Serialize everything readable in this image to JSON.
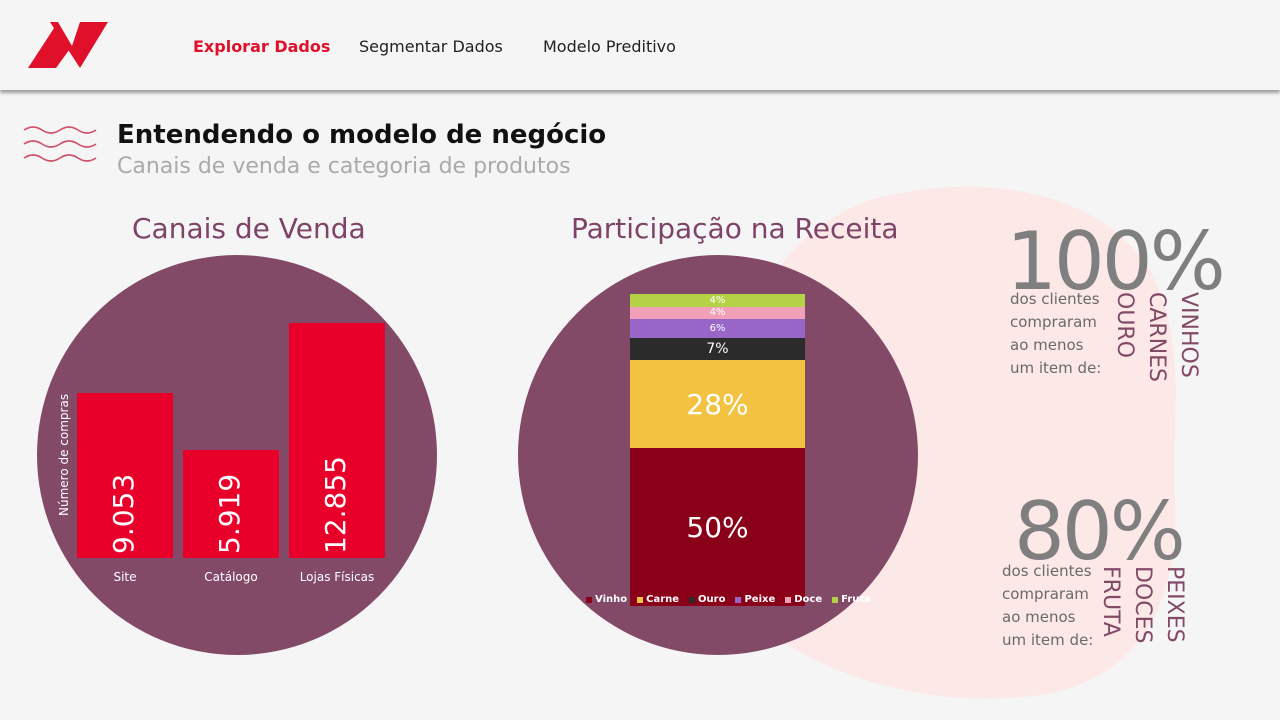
{
  "nav": {
    "items": [
      {
        "label": "Explorar Dados",
        "active": true
      },
      {
        "label": "Segmentar Dados",
        "active": false
      },
      {
        "label": "Modelo Preditivo",
        "active": false
      }
    ]
  },
  "header": {
    "title": "Entendendo o modelo de negócio",
    "subtitle": "Canais de venda  e categoria de produtos"
  },
  "colors": {
    "accent": "#e0102a",
    "circle": "#834a68",
    "bar": "#e8002a"
  },
  "chart_data": [
    {
      "type": "bar",
      "title": "Canais de Venda",
      "ylabel": "Número de compras",
      "categories": [
        "Site",
        "Catálogo",
        "Lojas Físicas"
      ],
      "values": [
        9053,
        5919,
        12855
      ],
      "value_labels": [
        "9.053",
        "5.919",
        "12.855"
      ],
      "ylim": [
        0,
        12855
      ]
    },
    {
      "type": "bar",
      "stacked": true,
      "title": "Participação na Receita",
      "series": [
        {
          "name": "Vinho",
          "value": 50,
          "label": "50%",
          "color": "#8b0019"
        },
        {
          "name": "Carne",
          "value": 28,
          "label": "28%",
          "color": "#f2c240"
        },
        {
          "name": "Ouro",
          "value": 7,
          "label": "7%",
          "color": "#2b2b2b"
        },
        {
          "name": "Peixe",
          "value": 6,
          "label": "6%",
          "color": "#9866c8"
        },
        {
          "name": "Doce",
          "value": 4,
          "label": "4%",
          "color": "#f2a0b8"
        },
        {
          "name": "Fruta",
          "value": 4,
          "label": "4%",
          "color": "#b5d145"
        }
      ],
      "legend": "bottom"
    }
  ],
  "stats": [
    {
      "percent": "100%",
      "caption_lines": [
        "dos clientes",
        "compraram",
        "ao menos",
        "um item de:"
      ],
      "categories": [
        "VINHOS",
        "CARNES",
        "OURO"
      ]
    },
    {
      "percent": "80%",
      "caption_lines": [
        "dos clientes",
        "compraram",
        "ao menos",
        "um item de:"
      ],
      "categories": [
        "PEIXES",
        "DOCES",
        "FRUTA"
      ]
    }
  ]
}
